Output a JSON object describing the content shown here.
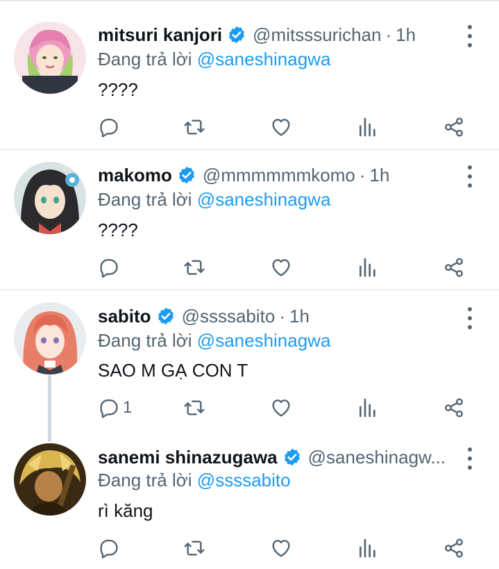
{
  "reply_prefix": "Đang trả lời",
  "tweets": [
    {
      "name": "mitsuri kanjori",
      "handle": "@mitsssurichan",
      "separator": "·",
      "time": "1h",
      "reply_to": "@saneshinagwa",
      "text": "????",
      "reply_count": "",
      "avatar": "avatar-pink-hair",
      "verified": true
    },
    {
      "name": "makomo",
      "handle": "@mmmmmmkomo",
      "separator": "·",
      "time": "1h",
      "reply_to": "@saneshinagwa",
      "text": "????",
      "reply_count": "",
      "avatar": "avatar-dark-hair",
      "verified": true
    },
    {
      "name": "sabito",
      "handle": "@ssssabito",
      "separator": "·",
      "time": "1h",
      "reply_to": "@saneshinagwa",
      "text": "SAO M GẠ CON T",
      "reply_count": "1",
      "avatar": "avatar-peach-hair",
      "verified": true
    },
    {
      "name": "sanemi shinazugawa",
      "handle": "@saneshinagw...",
      "separator": "",
      "time": "",
      "reply_to": "@ssssabito",
      "text": "rì kăng",
      "reply_count": "",
      "avatar": "avatar-gold-hair",
      "verified": true
    }
  ],
  "icons": {
    "reply": "reply-icon",
    "retweet": "retweet-icon",
    "like": "like-icon",
    "stats": "stats-icon",
    "share": "share-icon",
    "more": "more-icon",
    "verified": "verified-badge-icon"
  },
  "colors": {
    "link": "#1d9bf0",
    "secondary": "#536471",
    "primary_text": "#0f1419",
    "divider": "#ebeef0",
    "thread_line": "#cfd9de"
  }
}
